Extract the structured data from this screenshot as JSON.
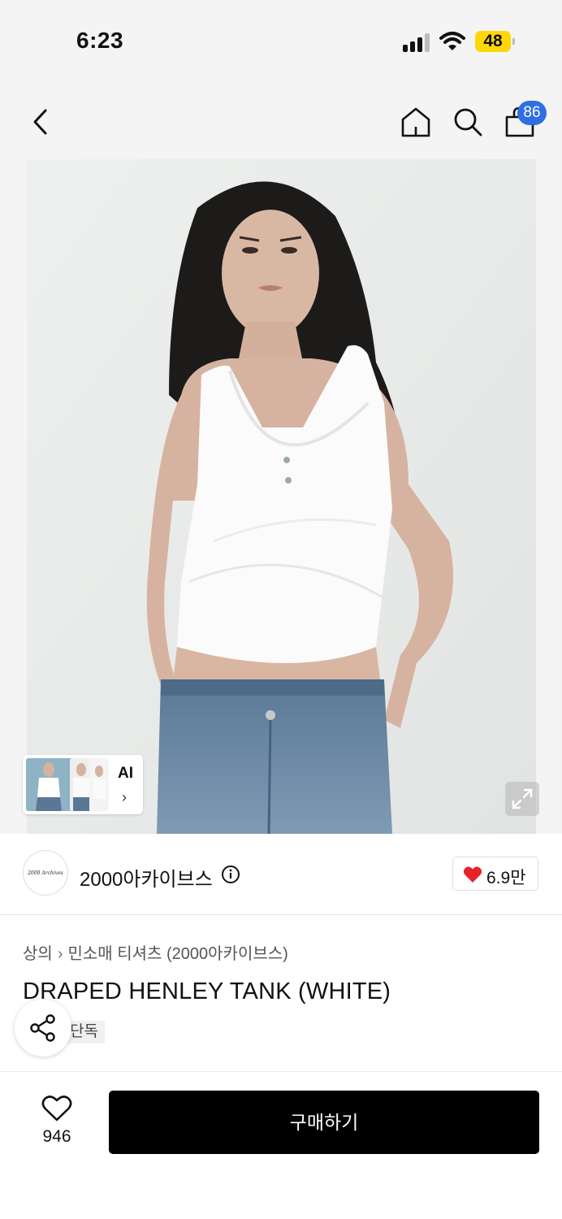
{
  "status_bar": {
    "time": "6:23",
    "battery": "48"
  },
  "nav": {
    "cart_count": "86",
    "icons": [
      "back-arrow-icon",
      "home-icon",
      "search-icon",
      "shopping-bag-icon"
    ]
  },
  "hero": {
    "ai_label": "AI",
    "ai_chevron": "›",
    "icons": [
      "expand-icon"
    ]
  },
  "brand": {
    "name": "2000아카이브스",
    "logo_text": "2000 Archives",
    "like_count": "6.9만"
  },
  "product": {
    "breadcrumb": [
      "상의",
      "민소매 티셔츠 (2000아카이브스)"
    ],
    "title": "DRAPED HENLEY TANK (WHITE)",
    "tag": "단독"
  },
  "bottom": {
    "wish_count": "946",
    "buy_label": "구매하기"
  },
  "colors": {
    "badge": "#2f6fe4",
    "heart": "#e5232b",
    "buy_bg": "#000000",
    "battery": "#ffd60a"
  }
}
